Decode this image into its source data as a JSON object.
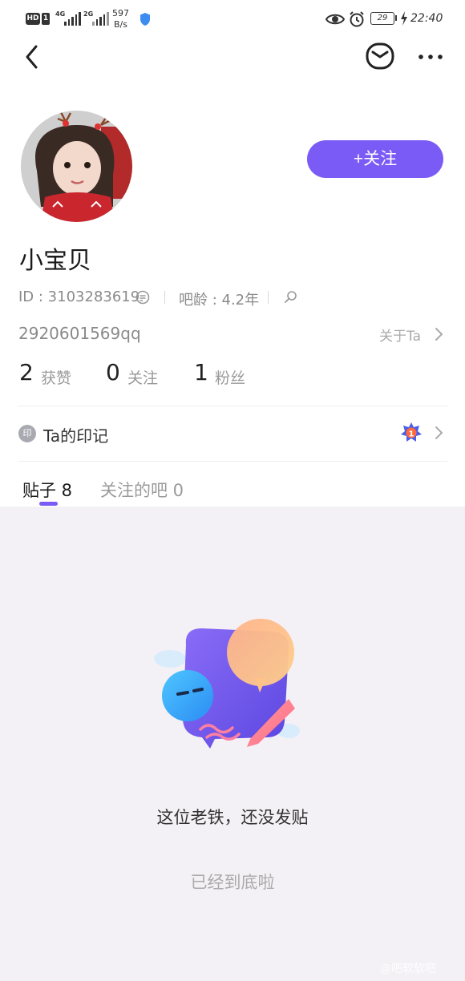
{
  "status_bar": {
    "hd": "HD",
    "sim": "1",
    "net1": "4G",
    "net2": "2G",
    "speed_value": "597",
    "speed_unit": "B/s",
    "battery": "29",
    "time": "22:40"
  },
  "nav": {
    "back_icon": "chevron-left-icon",
    "mail_icon": "mail-icon",
    "more_icon": "more-icon"
  },
  "profile": {
    "follow_label": "+关注",
    "username": "小宝贝",
    "id_text": "ID : 3103283619",
    "age_text": "吧龄 : 4.2年",
    "subname": "2920601569qq",
    "about_label": "关于Ta"
  },
  "stats": [
    {
      "value": "2",
      "label": "获赞"
    },
    {
      "value": "0",
      "label": "关注"
    },
    {
      "value": "1",
      "label": "粉丝"
    }
  ],
  "mark": {
    "icon_text": "印",
    "label": "Ta的印记",
    "badge_number": "1"
  },
  "tabs": {
    "posts": "贴子 8",
    "followed_bars": "关注的吧 0"
  },
  "content": {
    "empty_message": "这位老铁，还没发贴",
    "end_message": "已经到底啦",
    "watermark": "@吧软软吧"
  },
  "colors": {
    "accent": "#7a5bf5",
    "content_bg": "#f4f1f6"
  }
}
